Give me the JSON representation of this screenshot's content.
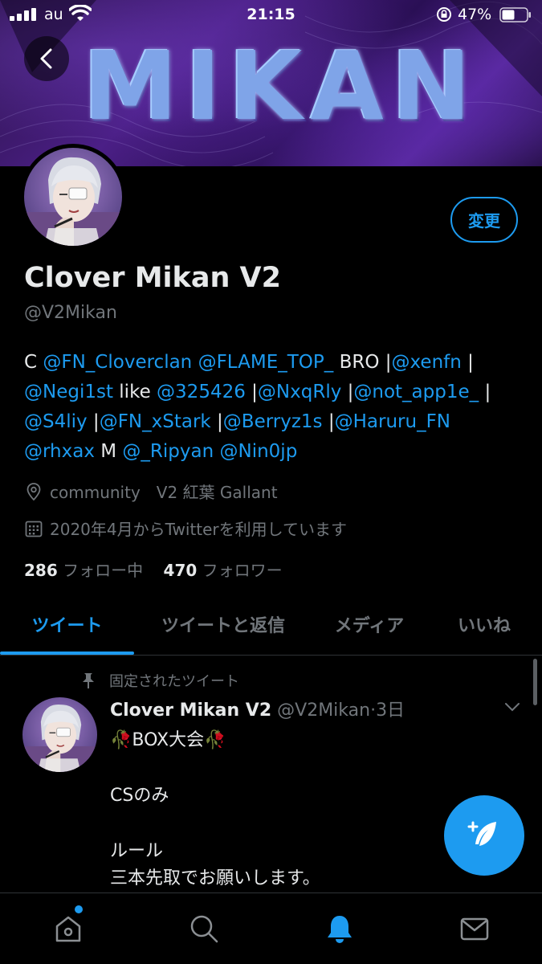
{
  "status_bar": {
    "carrier": "au",
    "time": "21:15",
    "battery": "47%"
  },
  "banner": {
    "title": "MIKAN"
  },
  "profile": {
    "change_button": "変更",
    "display_name": "Clover Mikan V2",
    "handle": "@V2Mikan",
    "bio": [
      [
        "C ",
        "t"
      ],
      [
        "@FN_Cloverclan",
        "m"
      ],
      [
        " ",
        "t"
      ],
      [
        "@FLAME_TOP_",
        "m"
      ],
      [
        " BRO |",
        "t"
      ],
      [
        "@xenfn",
        "m"
      ],
      [
        " |",
        "t"
      ],
      [
        "\n",
        "br"
      ],
      [
        "@Negi1st",
        "m"
      ],
      [
        " like ",
        "t"
      ],
      [
        "@325426",
        "m"
      ],
      [
        " |",
        "t"
      ],
      [
        "@NxqRly",
        "m"
      ],
      [
        " |",
        "t"
      ],
      [
        "@not_app1e_",
        "m"
      ],
      [
        " |",
        "t"
      ],
      [
        "\n",
        "br"
      ],
      [
        "@S4liy",
        "m"
      ],
      [
        " |",
        "t"
      ],
      [
        "@FN_xStark",
        "m"
      ],
      [
        " |",
        "t"
      ],
      [
        "@Berryz1s",
        "m"
      ],
      [
        " |",
        "t"
      ],
      [
        "@Haruru_FN",
        "m"
      ],
      [
        "\n",
        "br"
      ],
      [
        "@rhxax",
        "m"
      ],
      [
        " M ",
        "t"
      ],
      [
        "@_Ripyan",
        "m"
      ],
      [
        " ",
        "t"
      ],
      [
        "@Nin0jp",
        "m"
      ]
    ],
    "location": "community　V2 紅葉 Gallant",
    "joined": "2020年4月からTwitterを利用しています",
    "following_count": "286",
    "following_label": "フォロー中",
    "followers_count": "470",
    "followers_label": "フォロワー"
  },
  "tabs": [
    {
      "label": "ツイート",
      "active": true
    },
    {
      "label": "ツイートと返信",
      "active": false
    },
    {
      "label": "メディア",
      "active": false
    },
    {
      "label": "いいね",
      "active": false
    }
  ],
  "pinned_tweet": {
    "pinned_label": "固定されたツイート",
    "author_name": "Clover Mikan V2",
    "author_handle": "@V2Mikan",
    "time": "3日",
    "lines": [
      "🥀BOX大会🥀",
      "",
      "CSのみ",
      "",
      "ルール",
      "三本先取でお願いします。"
    ]
  },
  "colors": {
    "accent": "#1d9bf0",
    "background": "#000000",
    "muted": "#71767b"
  },
  "bottom_nav": [
    "home-icon",
    "search-icon",
    "notifications-icon",
    "messages-icon"
  ]
}
